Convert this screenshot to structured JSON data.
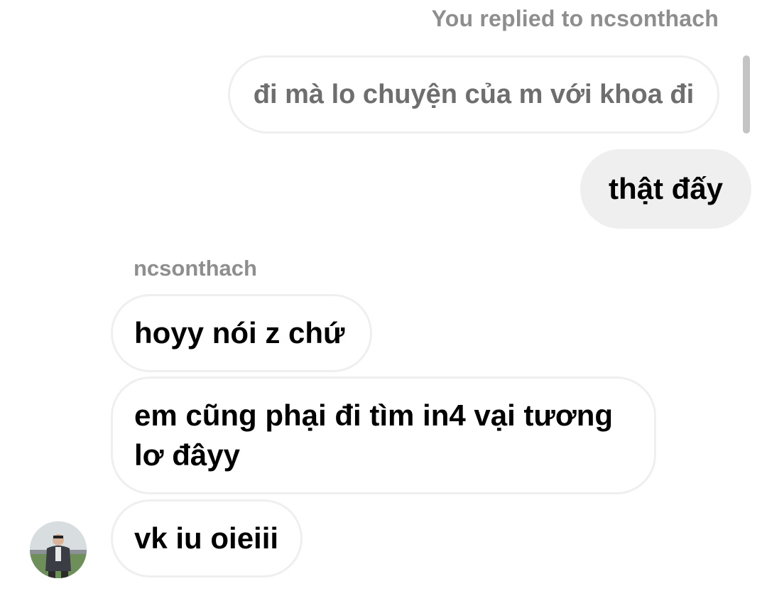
{
  "thread": {
    "reply_note": "You replied to ncsonthach",
    "quoted_message": "đi mà lo chuyện của m với khoa đi",
    "sent_message": "thật đấy",
    "sender_name": "ncsonthach",
    "received_messages": [
      "hoyy nói z chứ",
      "em cũng phại đi tìm in4 vại tương lơ đâyy",
      "vk iu oieiii"
    ]
  },
  "colors": {
    "sent_bubble": "#efefef",
    "meta_text": "#8e8e8e",
    "bubble_border": "#efefef"
  }
}
